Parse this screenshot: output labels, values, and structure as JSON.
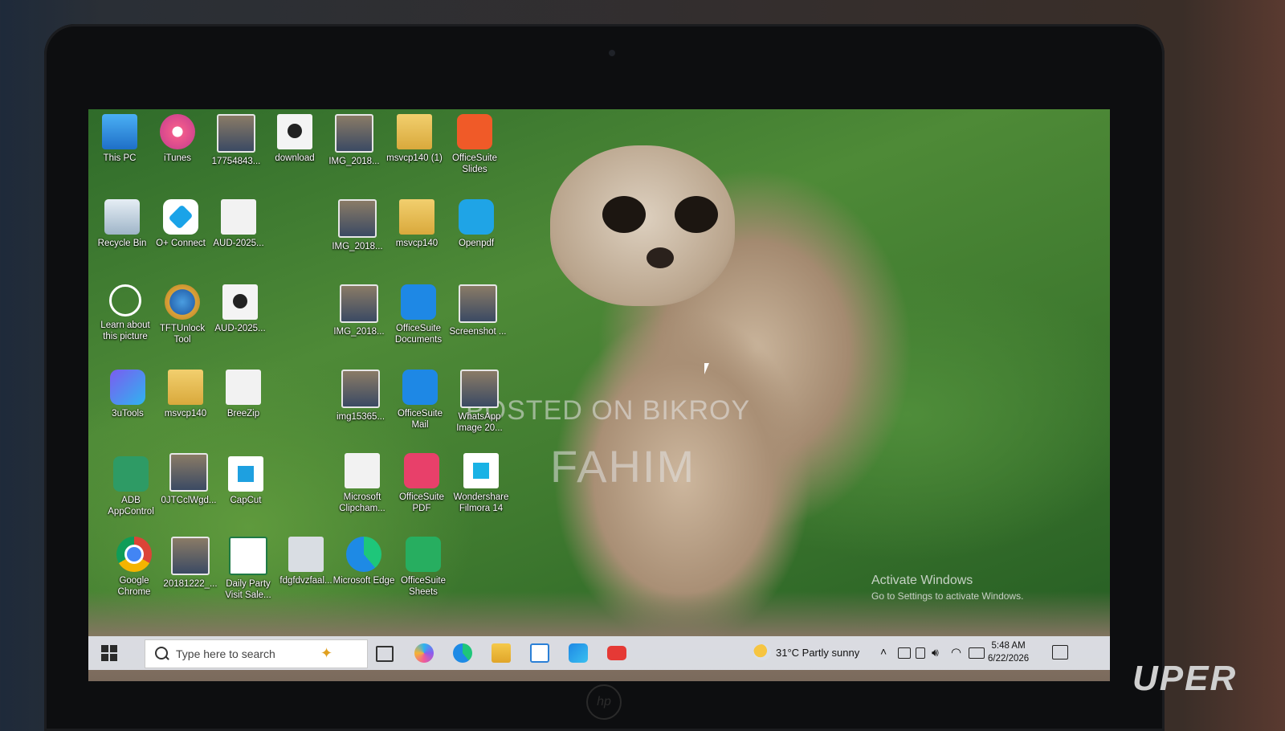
{
  "desktop": {
    "icons": [
      {
        "label": "This PC",
        "icon": "this-pc-icon"
      },
      {
        "label": "iTunes",
        "icon": "itunes-icon"
      },
      {
        "label": "17754843...",
        "icon": "photo-file-icon"
      },
      {
        "label": "download",
        "icon": "media-file-icon"
      },
      {
        "label": "IMG_2018...",
        "icon": "photo-file-icon"
      },
      {
        "label": "msvcp140 (1)",
        "icon": "zip-folder-icon"
      },
      {
        "label": "OfficeSuite Slides",
        "icon": "officesuite-slides-icon"
      },
      {
        "label": "Recycle Bin",
        "icon": "recycle-bin-icon"
      },
      {
        "label": "O+ Connect",
        "icon": "o-plus-connect-icon"
      },
      {
        "label": "AUD-2025...",
        "icon": "blank-file-icon"
      },
      {
        "label": "IMG_2018...",
        "icon": "photo-file-icon"
      },
      {
        "label": "msvcp140",
        "icon": "zip-folder-icon"
      },
      {
        "label": "Openpdf",
        "icon": "openpdf-icon"
      },
      {
        "label": "Learn about this picture",
        "icon": "learn-about-picture-icon"
      },
      {
        "label": "TFTUnlock Tool",
        "icon": "tftunlock-icon"
      },
      {
        "label": "AUD-2025...",
        "icon": "media-file-icon"
      },
      {
        "label": "IMG_2018...",
        "icon": "photo-file-icon"
      },
      {
        "label": "OfficeSuite Documents",
        "icon": "officesuite-documents-icon"
      },
      {
        "label": "Screenshot ...",
        "icon": "photo-file-icon"
      },
      {
        "label": "3uTools",
        "icon": "3utools-icon"
      },
      {
        "label": "msvcp140",
        "icon": "folder-icon"
      },
      {
        "label": "BreeZip",
        "icon": "blank-file-icon"
      },
      {
        "label": "img15365...",
        "icon": "photo-file-icon"
      },
      {
        "label": "OfficeSuite Mail",
        "icon": "officesuite-mail-icon"
      },
      {
        "label": "WhatsApp Image 20...",
        "icon": "photo-file-icon"
      },
      {
        "label": "ADB AppControl",
        "icon": "adb-appcontrol-icon"
      },
      {
        "label": "0JTCclWgd...",
        "icon": "photo-file-icon"
      },
      {
        "label": "CapCut",
        "icon": "capcut-icon"
      },
      {
        "label": "Microsoft Clipcham...",
        "icon": "blank-file-icon"
      },
      {
        "label": "OfficeSuite PDF",
        "icon": "officesuite-pdf-icon"
      },
      {
        "label": "Wondershare Filmora 14",
        "icon": "filmora-icon"
      },
      {
        "label": "Google Chrome",
        "icon": "chrome-icon"
      },
      {
        "label": "20181222_...",
        "icon": "photo-file-icon"
      },
      {
        "label": "Daily Party Visit Sale...",
        "icon": "excel-file-icon"
      },
      {
        "label": "fdgfdvzfaal...",
        "icon": "blank-file-icon"
      },
      {
        "label": "Microsoft Edge",
        "icon": "edge-icon"
      },
      {
        "label": "OfficeSuite Sheets",
        "icon": "officesuite-sheets-icon"
      }
    ],
    "watermark_line1": "POSTED ON BIKROY",
    "watermark_line2": "FAHIM",
    "activate_title": "Activate Windows",
    "activate_sub": "Go to Settings to activate Windows."
  },
  "taskbar": {
    "search_placeholder": "Type here to search",
    "pinned": [
      "task-view-icon",
      "copilot-icon",
      "edge-icon",
      "file-explorer-icon",
      "microsoft-store-icon",
      "outlook-icon",
      "youtube-icon"
    ],
    "weather": "31°C  Partly sunny",
    "time": "5:48 AM",
    "date": "6/22/2026"
  },
  "colors": {
    "taskbar_bg": "#e1e4eb",
    "youtube": "#e53935",
    "edge": "#1e8ae5"
  }
}
